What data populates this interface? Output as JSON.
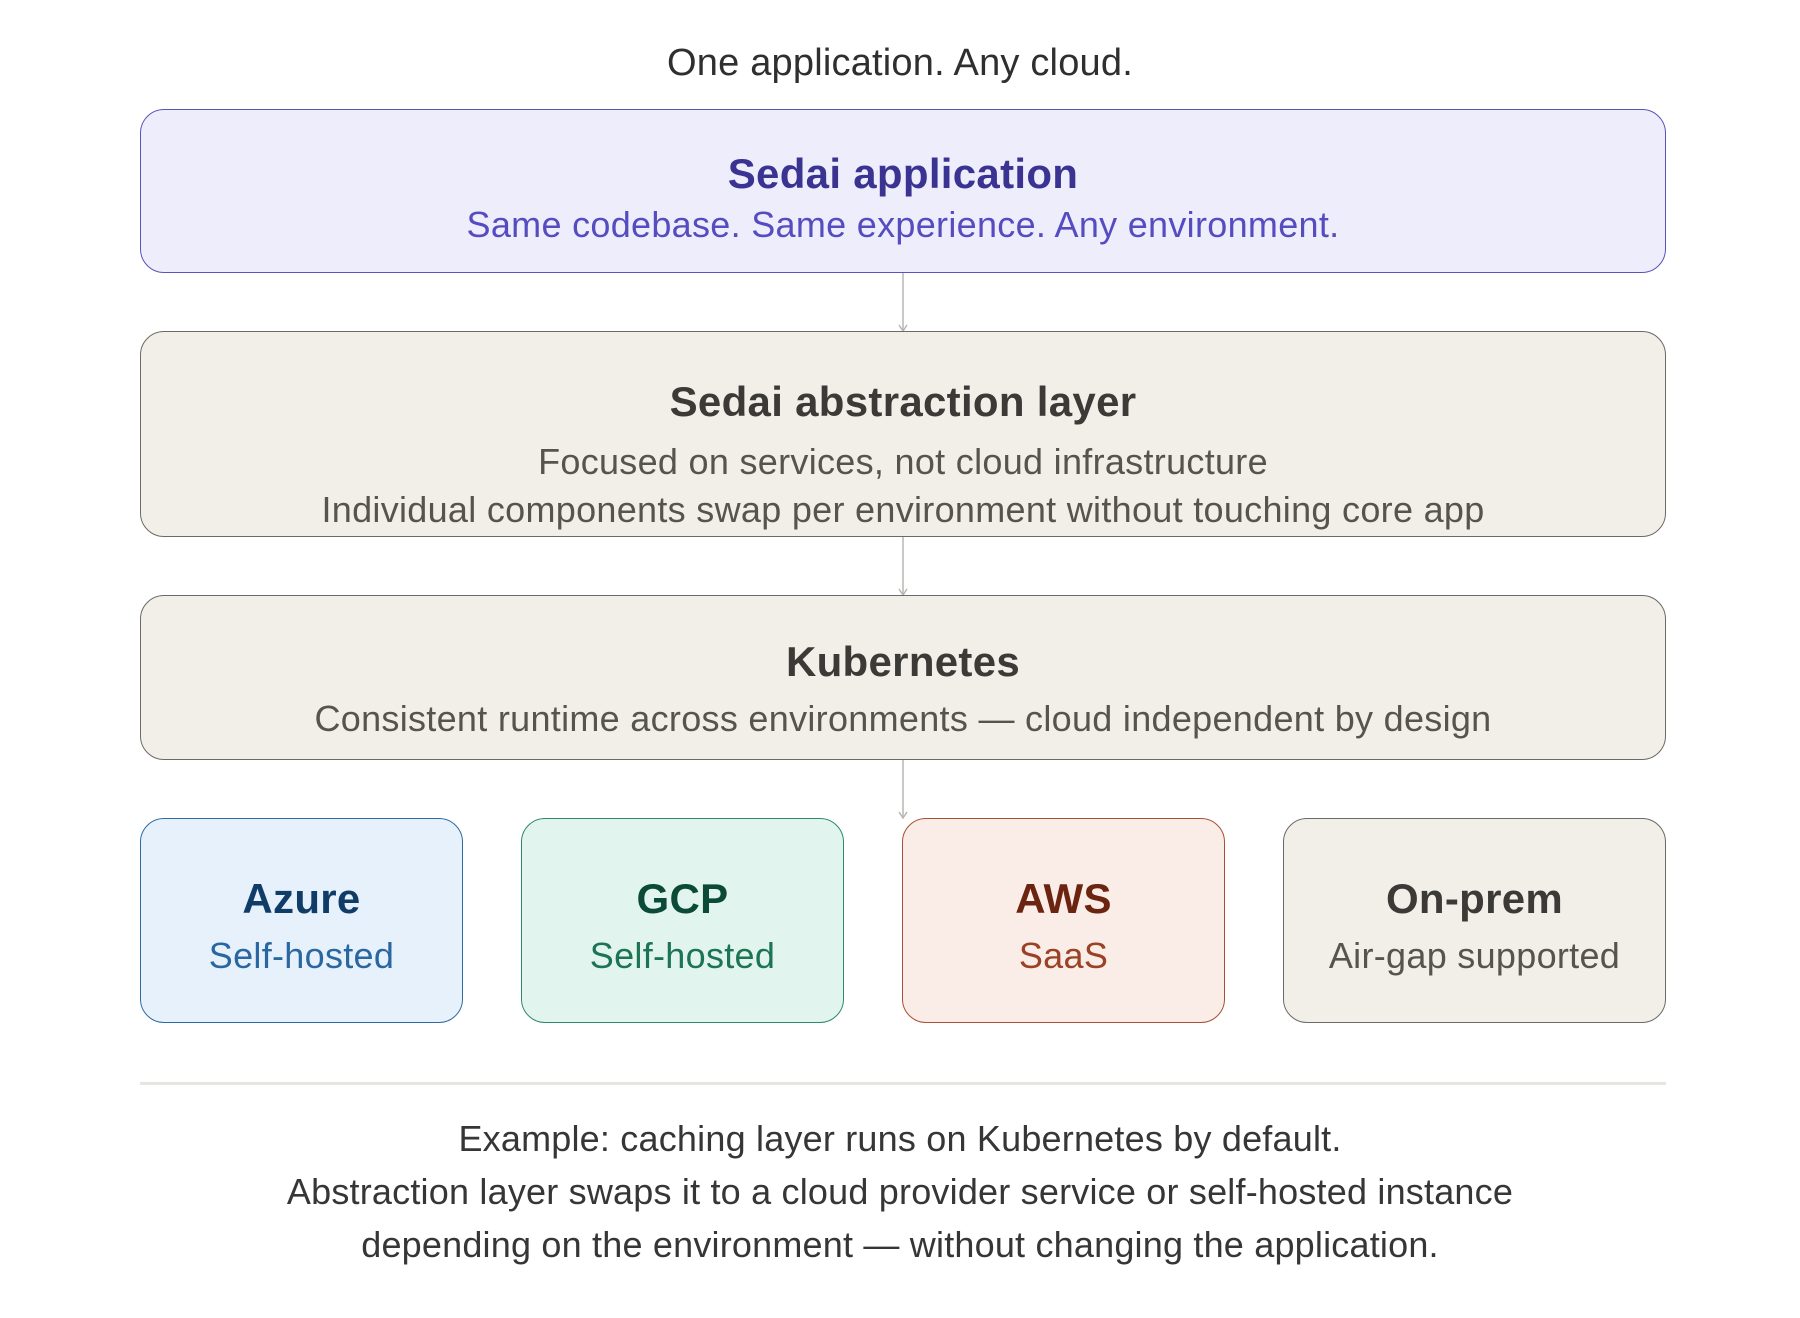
{
  "title": "One application. Any cloud.",
  "application": {
    "heading": "Sedai application",
    "subtitle": "Same codebase. Same experience. Any environment."
  },
  "abstraction": {
    "heading": "Sedai abstraction layer",
    "line1": "Focused on services, not cloud infrastructure",
    "line2": "Individual components swap per environment without touching core app"
  },
  "kubernetes": {
    "heading": "Kubernetes",
    "subtitle": "Consistent runtime across environments — cloud independent by design"
  },
  "clouds": [
    {
      "name": "Azure",
      "mode": "Self-hosted",
      "color": "#e6f1fb"
    },
    {
      "name": "GCP",
      "mode": "Self-hosted",
      "color": "#e1f5ee"
    },
    {
      "name": "AWS",
      "mode": "SaaS",
      "color": "#faece7"
    },
    {
      "name": "On-prem",
      "mode": "Air-gap supported",
      "color": "#f1efe8"
    }
  ],
  "footer": {
    "line1": "Example: caching layer runs on Kubernetes by default.",
    "line2": "Abstraction layer swaps it to a cloud provider service or self-hosted instance",
    "line3": "depending on the environment — without changing the application."
  },
  "colors": {
    "application_fill": "#ededfc",
    "application_border": "#5a54b8",
    "layer_fill": "#f1efe8",
    "connector": "#b8b7b2"
  }
}
